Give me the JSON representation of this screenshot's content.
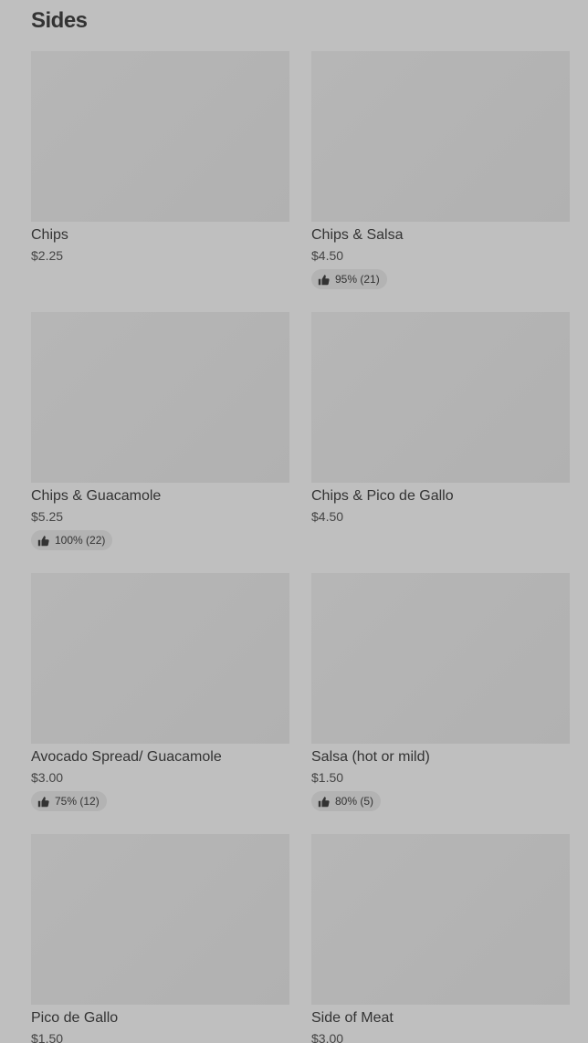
{
  "section": {
    "title": "Sides"
  },
  "items": [
    {
      "name": "Chips",
      "price": "$2.25",
      "rating": ""
    },
    {
      "name": "Chips & Salsa",
      "price": "$4.50",
      "rating": "95% (21)"
    },
    {
      "name": "Chips & Guacamole",
      "price": "$5.25",
      "rating": "100% (22)"
    },
    {
      "name": "Chips & Pico de Gallo",
      "price": "$4.50",
      "rating": ""
    },
    {
      "name": "Avocado Spread/ Guacamole",
      "price": "$3.00",
      "rating": "75% (12)"
    },
    {
      "name": "Salsa (hot or mild)",
      "price": "$1.50",
      "rating": "80% (5)"
    },
    {
      "name": "Pico de Gallo",
      "price": "$1.50",
      "rating": ""
    },
    {
      "name": "Side of Meat",
      "price": "$3.00",
      "rating": ""
    }
  ],
  "icons": {
    "rating": "thumbs-up-icon"
  },
  "colors": {
    "background": "#bfbfbf",
    "placeholder": "#b3b3b3",
    "text": "#333333"
  }
}
